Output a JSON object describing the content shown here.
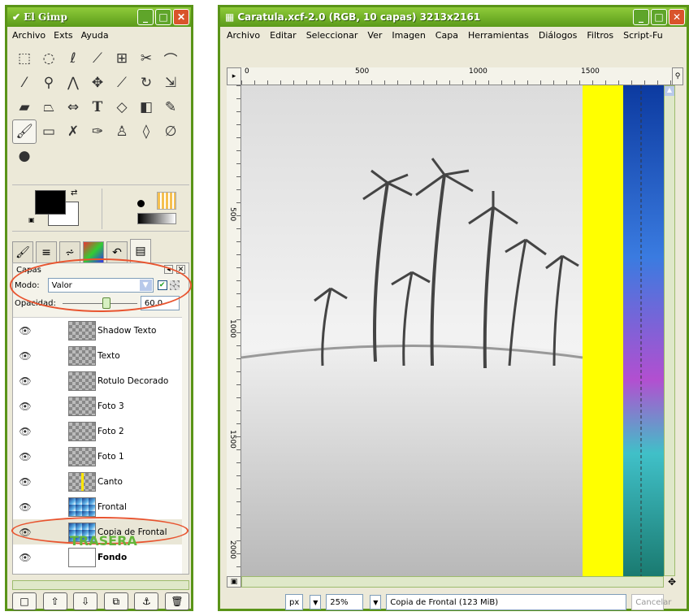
{
  "toolbox": {
    "title": "El Gimp",
    "menu": [
      "Archivo",
      "Exts",
      "Ayuda"
    ],
    "tools": [
      "rect-select",
      "ellipse-select",
      "free-select",
      "fuzzy-select",
      "color-select",
      "scissors",
      "foreground-select",
      "color-picker",
      "zoom",
      "measure",
      "move",
      "crop",
      "rotate",
      "scale",
      "shear",
      "perspective",
      "flip",
      "text",
      "bucket-fill",
      "gradient",
      "pencil",
      "paintbrush",
      "eraser",
      "airbrush",
      "ink",
      "clone",
      "smudge",
      "dodge-burn",
      "blur"
    ],
    "colors": {
      "fg": "#000000",
      "bg": "#ffffff",
      "title": "#7bbf2e",
      "accent": "#e8542f"
    }
  },
  "layers": {
    "panel_label": "Capas",
    "mode_label": "Modo:",
    "mode_value": "Valor",
    "opacity_label": "Opacidad:",
    "opacity_value": "60,0",
    "opacity_fraction": 0.6,
    "items": [
      {
        "name": "Shadow Texto",
        "selected": false
      },
      {
        "name": "Texto",
        "selected": false
      },
      {
        "name": "Rotulo Decorado",
        "selected": false
      },
      {
        "name": "Foto 3",
        "selected": false
      },
      {
        "name": "Foto 2",
        "selected": false
      },
      {
        "name": "Foto 1",
        "selected": false
      },
      {
        "name": "Canto",
        "selected": false
      },
      {
        "name": "Frontal",
        "selected": false
      },
      {
        "name": "Copia de Frontal",
        "selected": true
      },
      {
        "name": "Fondo",
        "selected": false
      }
    ],
    "annotation": "TRASERA"
  },
  "image_window": {
    "title": "Caratula.xcf-2.0 (RGB, 10 capas) 3213x2161",
    "menu": [
      "Archivo",
      "Editar",
      "Seleccionar",
      "Ver",
      "Imagen",
      "Capa",
      "Herramientas",
      "Diálogos",
      "Filtros",
      "Script-Fu"
    ],
    "ruler_h": [
      "0",
      "500",
      "1000",
      "1500"
    ],
    "ruler_v": [
      "500",
      "1000",
      "1500",
      "2000"
    ],
    "unit": "px",
    "zoom": "25%",
    "status": "Copia de Frontal (123 MiB)",
    "cancel": "Cancelar"
  }
}
